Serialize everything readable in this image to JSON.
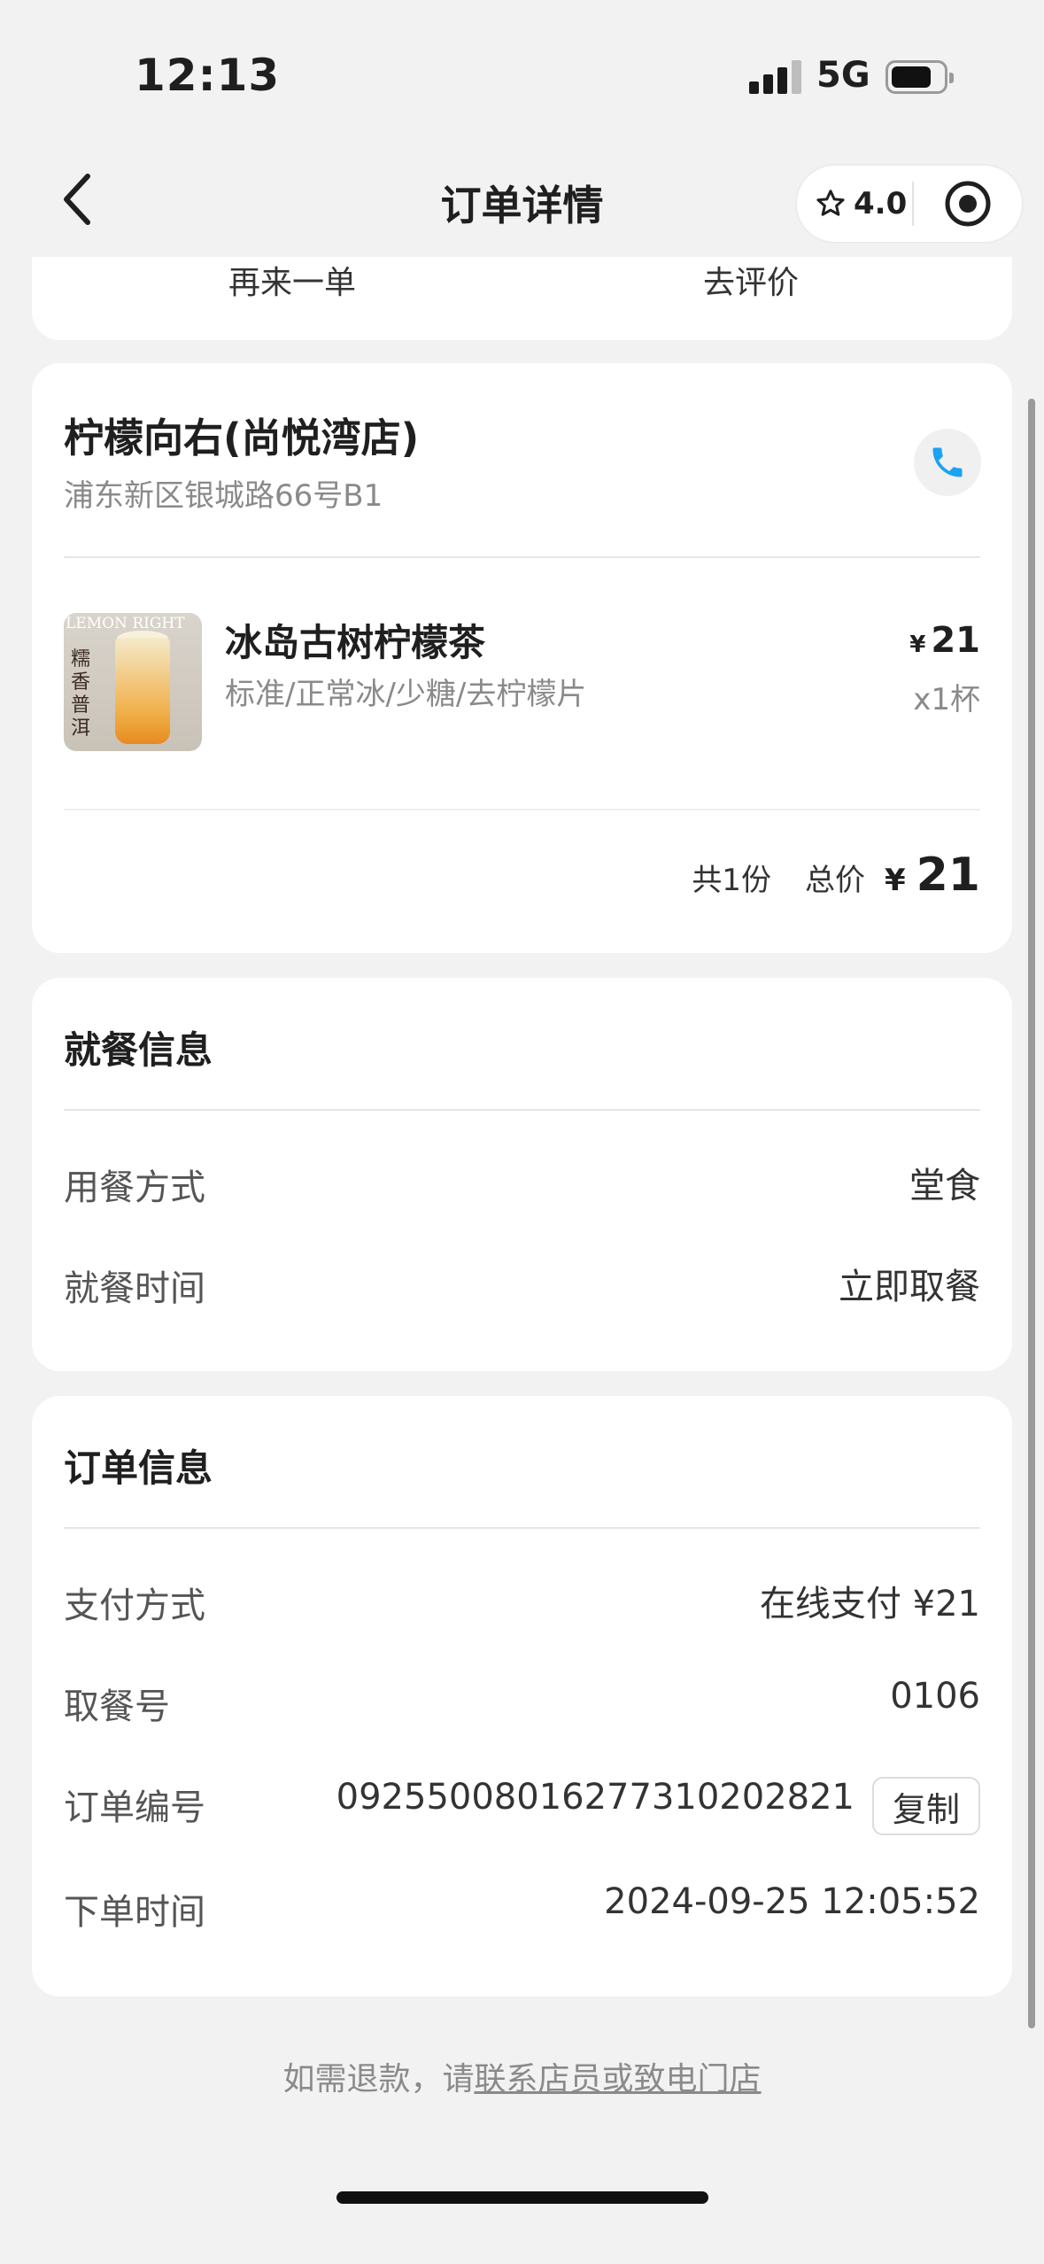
{
  "status_bar": {
    "time": "12:13",
    "network": "5G"
  },
  "nav": {
    "title": "订单详情",
    "rating": "4.0",
    "icons": [
      "back-arrow-icon",
      "star-icon",
      "target-icon"
    ]
  },
  "top_actions": {
    "reorder": "再来一单",
    "review": "去评价"
  },
  "store": {
    "name": "柠檬向右(尚悦湾店)",
    "address": "浦东新区银城路66号B1"
  },
  "item": {
    "name": "冰岛古树柠檬茶",
    "spec": "标准/正常冰/少糖/去柠檬片",
    "currency": "¥",
    "price": "21",
    "quantity": "x1杯",
    "thumb_brand": "LEMON RIGHT",
    "thumb_text": "糯香普洱"
  },
  "total": {
    "count": "共1份",
    "label": "总价",
    "currency": "¥",
    "value": "21"
  },
  "dining": {
    "title": "就餐信息",
    "rows": [
      {
        "label": "用餐方式",
        "value": "堂食"
      },
      {
        "label": "就餐时间",
        "value": "立即取餐"
      }
    ]
  },
  "order": {
    "title": "订单信息",
    "rows": [
      {
        "label": "支付方式",
        "value": "在线支付 ¥21"
      },
      {
        "label": "取餐号",
        "value": "0106"
      },
      {
        "label": "订单编号",
        "value": "09255008016277310202821"
      },
      {
        "label": "下单时间",
        "value": "2024-09-25 12:05:52"
      }
    ],
    "copy_label": "复制"
  },
  "footer": {
    "prefix": "如需退款，请",
    "link": "联系店员或致电门店"
  },
  "colors": {
    "phone_accent": "#1aa3f0",
    "background": "#f2f2f2"
  }
}
